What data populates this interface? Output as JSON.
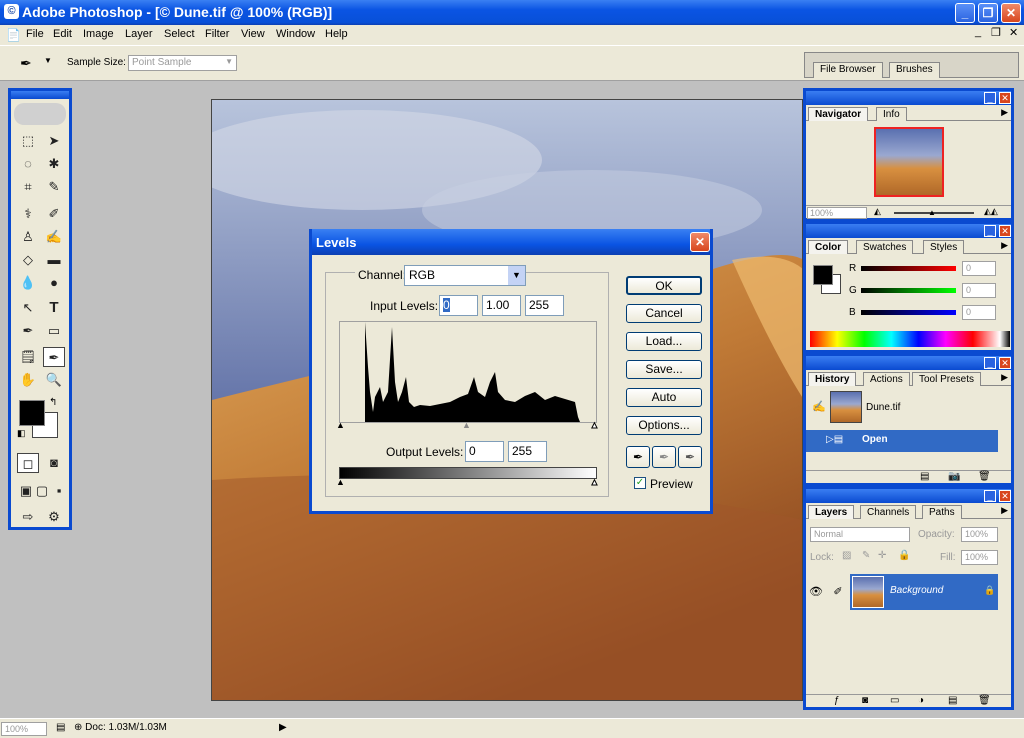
{
  "window": {
    "title": "Adobe Photoshop - [© Dune.tif @ 100% (RGB)]",
    "icon": "photoshop-icon"
  },
  "menu": [
    "File",
    "Edit",
    "Image",
    "Layer",
    "Select",
    "Filter",
    "View",
    "Window",
    "Help"
  ],
  "options": {
    "sample_size_label": "Sample Size:",
    "sample_size_value": "Point Sample",
    "file_browser": "File Browser",
    "brushes": "Brushes"
  },
  "dialog": {
    "title": "Levels",
    "channel_label": "Channel:",
    "channel_value": "RGB",
    "input_label": "Input Levels:",
    "input_black": "0",
    "input_gamma": "1.00",
    "input_white": "255",
    "output_label": "Output Levels:",
    "output_black": "0",
    "output_white": "255",
    "ok": "OK",
    "cancel": "Cancel",
    "load": "Load...",
    "save": "Save...",
    "auto": "Auto",
    "options": "Options...",
    "preview": "Preview",
    "preview_checked": true
  },
  "navigator": {
    "tabs": [
      "Navigator",
      "Info"
    ],
    "zoom": "100%"
  },
  "color": {
    "tabs": [
      "Color",
      "Swatches",
      "Styles"
    ],
    "r_label": "R",
    "g_label": "G",
    "b_label": "B",
    "r_value": "0",
    "g_value": "0",
    "b_value": "0"
  },
  "history": {
    "tabs": [
      "History",
      "Actions",
      "Tool Presets"
    ],
    "snapshot": "Dune.tif",
    "state": "Open"
  },
  "layers": {
    "tabs": [
      "Layers",
      "Channels",
      "Paths"
    ],
    "blend": "Normal",
    "opacity_label": "Opacity:",
    "opacity": "100%",
    "lock_label": "Lock:",
    "fill_label": "Fill:",
    "fill": "100%",
    "layer_name": "Background"
  },
  "status": {
    "zoom": "100%",
    "doc": "Doc: 1.03M/1.03M"
  }
}
